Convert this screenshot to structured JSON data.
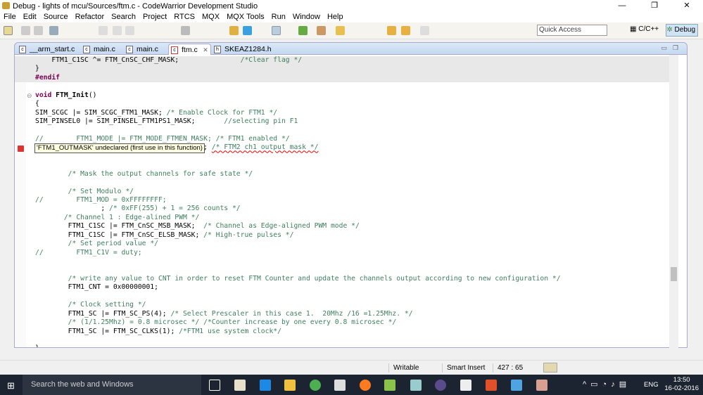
{
  "window": {
    "title": "Debug - lights of mcu/Sources/ftm.c - CodeWarrior Development Studio",
    "minimize": "—",
    "restore": "❐",
    "close": "✕"
  },
  "menu": [
    "File",
    "Edit",
    "Source",
    "Refactor",
    "Search",
    "Project",
    "RTCS",
    "MQX",
    "MQX Tools",
    "Run",
    "Window",
    "Help"
  ],
  "toolbar": {
    "quick_access_placeholder": "Quick Access",
    "perspectives": [
      "C/C++",
      "Debug"
    ]
  },
  "tabs": [
    {
      "label": "__arm_start.c"
    },
    {
      "label": "main.c"
    },
    {
      "label": "main.c"
    },
    {
      "label": "ftm.c",
      "active": true,
      "close": "✕"
    },
    {
      "label": "SKEAZ1284.h"
    }
  ],
  "editor": {
    "tooltip": "'FTM1_OUTMASK' undeclared (first use in this function)",
    "lines": [
      [
        {
          "t": "    FTM1_C1SC ^= FTM_CnSC_CHF_MASK;               "
        },
        {
          "t": "/*Clear flag */",
          "c": "cm"
        }
      ],
      [
        {
          "t": "}"
        }
      ],
      [
        {
          "t": "#endif",
          "c": "kw"
        }
      ],
      [],
      [
        {
          "t": "void ",
          "c": "kw"
        },
        {
          "t": "FTM_Init",
          "c": "fn"
        },
        {
          "t": "()"
        }
      ],
      [
        {
          "t": "{"
        }
      ],
      [
        {
          "t": "SIM_SCGC |= SIM_SCGC_FTM1_MASK; "
        },
        {
          "t": "/* Enable Clock for FTM1 */",
          "c": "cm"
        }
      ],
      [
        {
          "t": "SIM_PINSEL0 |= SIM_PINSEL_FTM1PS1_MASK;       "
        },
        {
          "t": "//selecting pin F1",
          "c": "cm"
        }
      ],
      [],
      [
        {
          "t": "//        FTM1_MODE |= FTM_MODE_FTMEN_MASK; /* FTM1 enabled */",
          "c": "cm"
        }
      ],
      [
        {
          "t": "                                         ; "
        },
        {
          "t": "/* FTM2 ch1 output mask */",
          "c": "cm sq"
        }
      ],
      [],
      [],
      [
        {
          "t": "        "
        },
        {
          "t": "/* Mask the output channels for safe state */",
          "c": "cm"
        }
      ],
      [],
      [
        {
          "t": "        "
        },
        {
          "t": "/* Set Modulo */",
          "c": "cm"
        }
      ],
      [
        {
          "t": "//        FTM1_MOD = 0xFFFFFFFF;",
          "c": "cm"
        }
      ],
      [
        {
          "t": "                ; "
        },
        {
          "t": "/* 0xFF(255) + 1 = 256 counts */",
          "c": "cm"
        }
      ],
      [
        {
          "t": "       "
        },
        {
          "t": "/* Channel 1 : Edge-alined PWM */",
          "c": "cm"
        }
      ],
      [
        {
          "t": "        FTM1_C1SC |= FTM_CnSC_MSB_MASK;  "
        },
        {
          "t": "/* Channel as Edge-aligned PWM mode */",
          "c": "cm"
        }
      ],
      [
        {
          "t": "        FTM1_C1SC |= FTM_CnSC_ELSB_MASK; "
        },
        {
          "t": "/* High-true pulses */",
          "c": "cm"
        }
      ],
      [
        {
          "t": "        "
        },
        {
          "t": "/* Set period value */",
          "c": "cm"
        }
      ],
      [
        {
          "t": "//        FTM1_C1V = duty;",
          "c": "cm"
        }
      ],
      [],
      [],
      [
        {
          "t": "        "
        },
        {
          "t": "/* write any value to CNT in order to reset FTM Counter and update the channels output according to new configuration */",
          "c": "cm"
        }
      ],
      [
        {
          "t": "        FTM1_CNT = 0x00000001;"
        }
      ],
      [],
      [
        {
          "t": "        "
        },
        {
          "t": "/* Clock setting */",
          "c": "cm"
        }
      ],
      [
        {
          "t": "        FTM1_SC |= FTM_SC_PS(4); "
        },
        {
          "t": "/* Select Prescaler in this case 1.  20Mhz /16 =1.25Mhz. */",
          "c": "cm"
        }
      ],
      [
        {
          "t": "        "
        },
        {
          "t": "/* (1/1.25Mhz) = 0.8 microsec */ /*Counter increase by one every 0.8 microsec */",
          "c": "cm"
        }
      ],
      [
        {
          "t": "        FTM1_SC |= FTM_SC_CLKS(1); "
        },
        {
          "t": "/*FTM1 use system clock*/",
          "c": "cm"
        }
      ],
      [],
      [
        {
          "t": "}"
        }
      ]
    ]
  },
  "status": {
    "mode": "Writable",
    "insert": "Smart Insert",
    "position": "427 : 65"
  },
  "taskbar": {
    "search_placeholder": "Search the web and Windows",
    "language": "ENG",
    "time": "13:50",
    "date": "16-02-2016"
  },
  "colors": {
    "keyword": "#7f0055",
    "comment": "#3f7f5f",
    "tab_bar": "#c5d9f1",
    "taskbar": "#1b2430"
  }
}
